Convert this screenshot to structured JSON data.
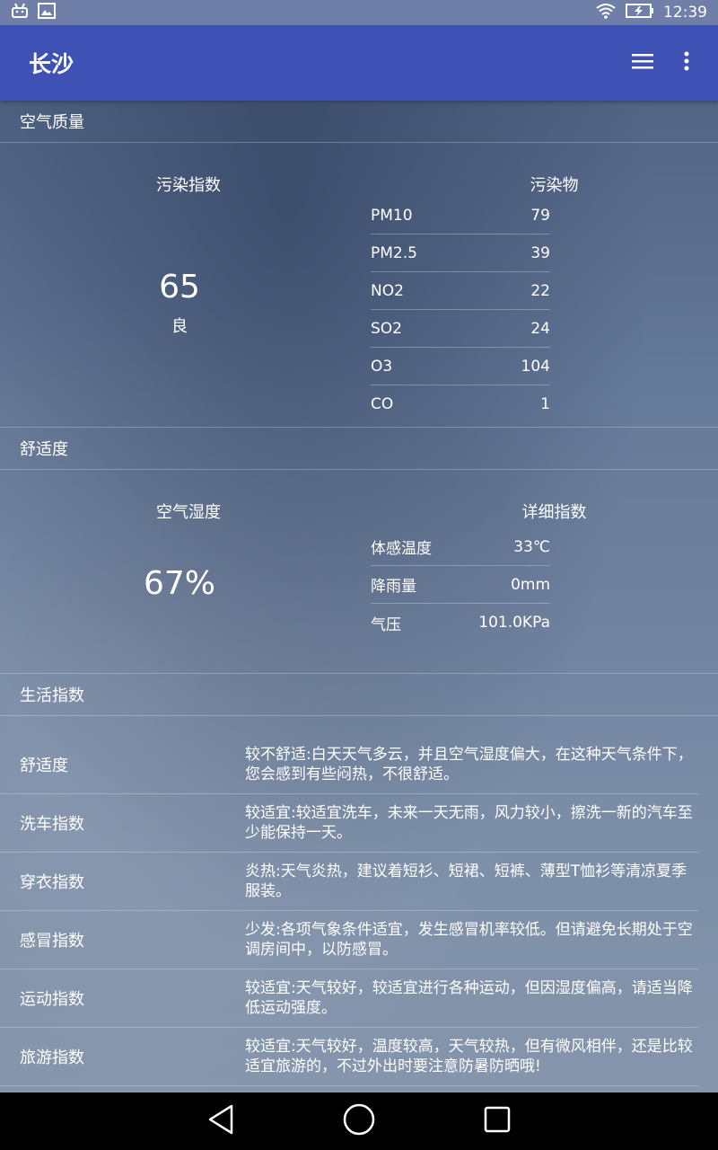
{
  "status_bar": {
    "left_icons": [
      "android-debug-icon",
      "image-icon"
    ],
    "right_icons": [
      "wifi-icon",
      "battery-charging-icon"
    ],
    "time": "12:39"
  },
  "app_bar": {
    "title": "长沙",
    "actions": [
      "menu-list-icon",
      "more-vert-icon"
    ],
    "background": "#3e51b5"
  },
  "air_quality": {
    "section_title": "空气质量",
    "index_heading": "污染指数",
    "aqi_value": "65",
    "aqi_level": "良",
    "pollutants_heading": "污染物",
    "pollutants": [
      {
        "name": "PM10",
        "value": "79"
      },
      {
        "name": "PM2.5",
        "value": "39"
      },
      {
        "name": "NO2",
        "value": "22"
      },
      {
        "name": "SO2",
        "value": "24"
      },
      {
        "name": "O3",
        "value": "104"
      },
      {
        "name": "CO",
        "value": "1"
      }
    ]
  },
  "comfort": {
    "section_title": "舒适度",
    "humidity_heading": "空气湿度",
    "humidity_value": "67%",
    "detail_heading": "详细指数",
    "details": [
      {
        "name": "体感温度",
        "value": "33℃"
      },
      {
        "name": "降雨量",
        "value": "0mm"
      },
      {
        "name": "气压",
        "value": "101.0KPa"
      }
    ]
  },
  "life_index": {
    "section_title": "生活指数",
    "items": [
      {
        "name": "舒适度",
        "desc": "较不舒适:白天天气多云，并且空气湿度偏大，在这种天气条件下，您会感到有些闷热，不很舒适。"
      },
      {
        "name": "洗车指数",
        "desc": "较适宜:较适宜洗车，未来一天无雨，风力较小，擦洗一新的汽车至少能保持一天。"
      },
      {
        "name": "穿衣指数",
        "desc": "炎热:天气炎热，建议着短衫、短裙、短裤、薄型T恤衫等清凉夏季服装。"
      },
      {
        "name": "感冒指数",
        "desc": "少发:各项气象条件适宜，发生感冒机率较低。但请避免长期处于空调房间中，以防感冒。"
      },
      {
        "name": "运动指数",
        "desc": "较适宜:天气较好，较适宜进行各种运动，但因湿度偏高，请适当降低运动强度。"
      },
      {
        "name": "旅游指数",
        "desc": "较适宜:天气较好，温度较高，天气较热，但有微风相伴，还是比较适宜旅游的，不过外出时要注意防暑防晒哦!"
      }
    ]
  },
  "nav_bar": {
    "buttons": [
      "back-icon",
      "home-icon",
      "recents-icon"
    ]
  }
}
